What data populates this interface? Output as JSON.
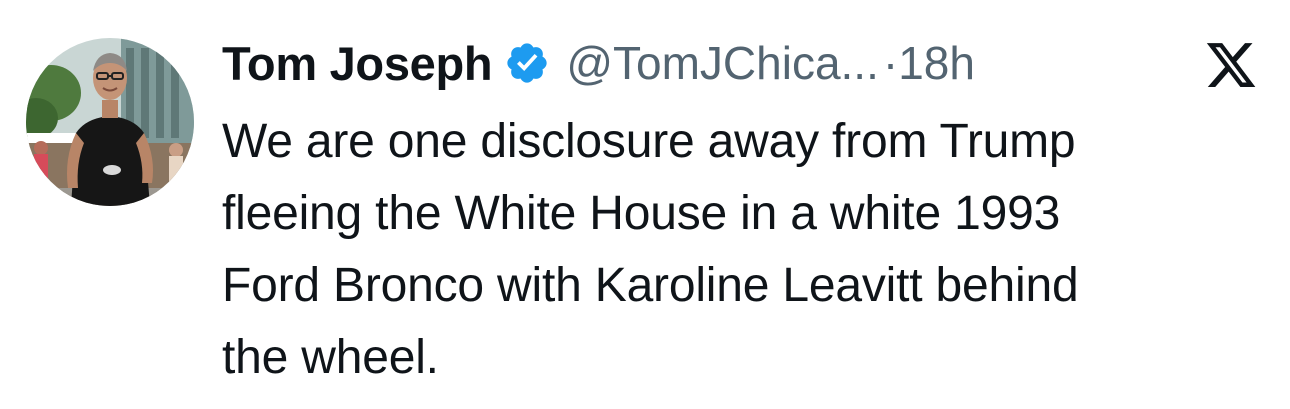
{
  "author": {
    "display_name": "Tom Joseph",
    "handle": "@TomJChica...",
    "separator": "·",
    "timestamp": "18h",
    "verified_icon": "verified-badge-icon",
    "avatar_icon": "profile-photo"
  },
  "tweet": {
    "lines": [
      "We are one disclosure away from Trump",
      "fleeing the White House in a white 1993",
      "Ford Bronco with Karoline Leavitt behind",
      "the wheel."
    ]
  },
  "platform_logo": "x-logo-icon",
  "colors": {
    "text": "#0f1419",
    "secondary": "#536471",
    "verified": "#1d9bf0",
    "background": "#ffffff"
  }
}
